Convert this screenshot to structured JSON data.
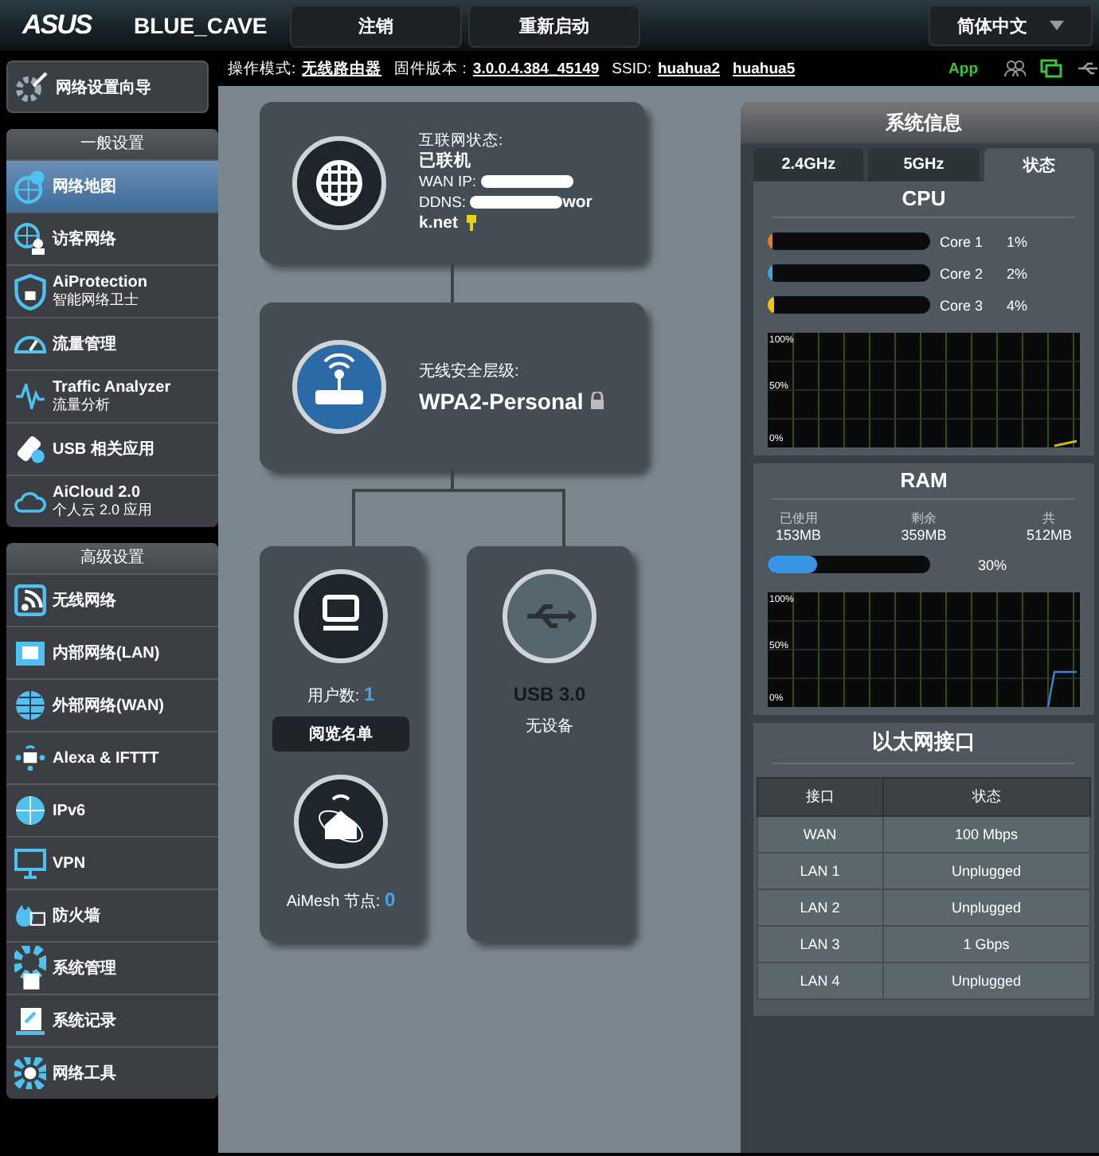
{
  "header": {
    "logo": "ASUS",
    "model": "BLUE_CAVE",
    "buttons": [
      "注销",
      "重新启动"
    ],
    "language": "简体中文"
  },
  "quick_setup": {
    "label": "网络设置向导"
  },
  "sidebar": [
    {
      "title": "一般设置",
      "items": [
        {
          "label": "网络地图",
          "selected": true
        },
        {
          "label": "访客网络",
          "selected": false
        },
        {
          "label": "AiProtection",
          "sublabel": "智能网络卫士",
          "selected": false
        },
        {
          "label": "流量管理",
          "selected": false
        },
        {
          "label": "Traffic Analyzer",
          "sublabel": "流量分析",
          "selected": false
        },
        {
          "label": "USB 相关应用",
          "selected": false
        },
        {
          "label": "AiCloud 2.0",
          "sublabel": "个人云 2.0 应用",
          "selected": false
        }
      ]
    },
    {
      "title": "高级设置",
      "items": [
        {
          "label": "无线网络",
          "selected": false
        },
        {
          "label": "内部网络(LAN)",
          "selected": false
        },
        {
          "label": "外部网络(WAN)",
          "selected": false
        },
        {
          "label": "Alexa & IFTTT",
          "selected": false
        },
        {
          "label": "IPv6",
          "selected": false
        },
        {
          "label": "VPN",
          "selected": false
        },
        {
          "label": "防火墙",
          "selected": false
        },
        {
          "label": "系统管理",
          "selected": false
        },
        {
          "label": "系统记录",
          "selected": false
        },
        {
          "label": "网络工具",
          "selected": false
        }
      ]
    }
  ],
  "info_bar": {
    "mode_label": "操作模式:",
    "mode": "无线路由器",
    "firmware_label": "固件版本 :",
    "firmware": "3.0.0.4.384_45149",
    "ssid_label": "SSID:",
    "ssids": [
      "huahua2",
      "huahua5"
    ],
    "app": "App"
  },
  "network_map": {
    "internet": {
      "status_label": "互联网状态:",
      "status": "已联机",
      "wan_ip_label": "WAN IP:",
      "ddns_label": "DDNS:",
      "ddns_lines": [
        "wor",
        "k.net"
      ]
    },
    "security": {
      "label": "无线安全层级:",
      "value": "WPA2-Personal"
    },
    "clients": {
      "label": "用户数:",
      "count": "1",
      "button": "阅览名单",
      "aimesh_label": "AiMesh 节点:",
      "aimesh_count": "0"
    },
    "usb": {
      "label": "USB 3.0",
      "status": "无设备"
    }
  },
  "system_info": {
    "title": "系统信息",
    "tabs": [
      {
        "label": "2.4GHz",
        "selected": false
      },
      {
        "label": "5GHz",
        "selected": false
      },
      {
        "label": "状态",
        "selected": true
      }
    ],
    "cpu": {
      "title": "CPU",
      "cores": [
        {
          "name": "Core 1",
          "reading": "1%",
          "level": 0.01,
          "color": "#e0801e"
        },
        {
          "name": "Core 2",
          "reading": "2%",
          "level": 0.02,
          "color": "#3aa8e0"
        },
        {
          "name": "Core 3",
          "reading": "4%",
          "level": 0.04,
          "color": "#f2c21b"
        }
      ],
      "graph_ticks": [
        "100%",
        "50%",
        "0%"
      ]
    },
    "ram": {
      "title": "RAM",
      "stats": [
        {
          "label": "已使用",
          "value": "153MB"
        },
        {
          "label": "剩余",
          "value": "359MB"
        },
        {
          "label": "共",
          "value": "512MB"
        }
      ],
      "level": 0.3,
      "reading": "30%",
      "graph_ticks": [
        "100%",
        "50%",
        "0%"
      ]
    },
    "ethernet": {
      "title": "以太网接口",
      "columns": [
        "接口",
        "状态"
      ],
      "rows": [
        [
          "WAN",
          "100 Mbps"
        ],
        [
          "LAN 1",
          "Unplugged"
        ],
        [
          "LAN 2",
          "Unplugged"
        ],
        [
          "LAN 3",
          "1 Gbps"
        ],
        [
          "LAN 4",
          "Unplugged"
        ]
      ]
    }
  }
}
